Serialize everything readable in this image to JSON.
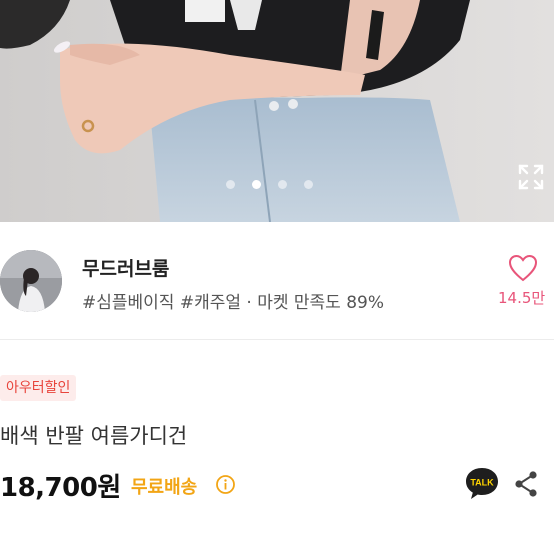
{
  "seller": {
    "name": "무드러브룸",
    "tags": "#심플베이직 #캐주얼 · 마켓 만족도 89%",
    "likes": "14.5만"
  },
  "product": {
    "badge": "아우터할인",
    "title": "배색 반팔 여름가디건",
    "price": "18,700원",
    "shipping": "무료배송"
  },
  "talk_label": "TALK",
  "carousel": {
    "total": 4,
    "active_index": 1
  },
  "colors": {
    "like": "#e8557a",
    "shipping": "#f2a515",
    "badge_text": "#e8453c",
    "badge_bg": "#fdeceb",
    "talk_bubble": "#1e1e1e"
  },
  "icons": [
    "expand-icon",
    "heart-icon",
    "info-icon",
    "kakaotalk-icon",
    "share-icon"
  ]
}
